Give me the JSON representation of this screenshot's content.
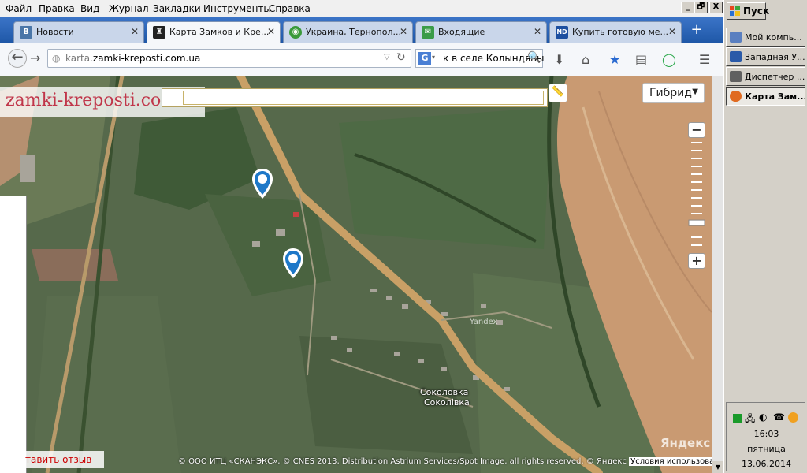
{
  "menu": [
    "Файл",
    "Правка",
    "Вид",
    "Журнал",
    "Закладки",
    "Инструменты",
    "Справка"
  ],
  "window_controls": [
    "_",
    "🗗",
    "X"
  ],
  "tabs": [
    {
      "label": "Новости",
      "icon": "vk-icon",
      "icon_text": "В",
      "color": "#4a76a8"
    },
    {
      "label": "Карта Замков и Кре...",
      "icon": "castle-icon",
      "icon_text": "♜",
      "color": "#222222"
    },
    {
      "label": "Украина, Тернопол...",
      "icon": "globe-icon",
      "icon_text": "◉",
      "color": "#3a9a3a"
    },
    {
      "label": "Входящие",
      "icon": "mail-icon",
      "icon_text": "✉",
      "color": "#3b9c48"
    },
    {
      "label": "Купить готовую ме...",
      "icon": "nd-icon",
      "icon_text": "ND",
      "color": "#1d4fa0"
    }
  ],
  "address": {
    "scheme": "karta.",
    "domain": "zamki-kreposti.com.ua"
  },
  "search": {
    "engine": "G",
    "query": "к в селе Колындяны"
  },
  "map": {
    "logo": "zamki-kreposti.com.ua",
    "layer": "Гибрид",
    "zoom_level": 0.77,
    "feedback": "тавить отзыв",
    "copyright": "© ООО ИТЦ «СКАНЭКС», © CNES 2013, Distribution Astrium Services/Spot Image, all rights reserved, © Яндекс",
    "terms": "Условия использования",
    "watermark": "Яндекс",
    "small_watermark": "Yandex",
    "place_ru": "Соколовка",
    "place_ua": "Соколівка"
  },
  "taskbar": {
    "start": "Пуск",
    "items": [
      {
        "label": "Мой компь...",
        "color": "#5a7fc0"
      },
      {
        "label": "Западная У...",
        "color": "#2a5aa8"
      },
      {
        "label": "Диспетчер ...",
        "color": "#606060"
      },
      {
        "label": "Карта Зам...",
        "color": "#e06a20"
      }
    ],
    "time": "16:03",
    "day": "пятница",
    "date": "13.06.2014"
  }
}
